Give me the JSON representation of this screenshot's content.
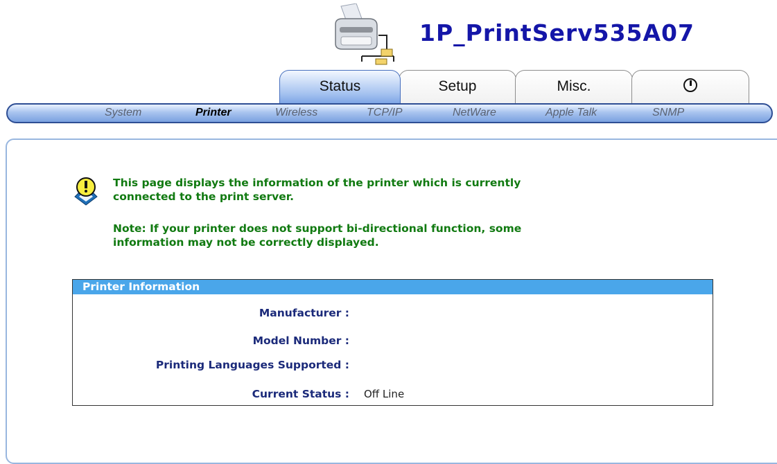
{
  "header": {
    "device_name": "1P_PrintServ535A07",
    "logo_icon": "printer-network-icon"
  },
  "tabs": [
    {
      "label": "Status",
      "active": true
    },
    {
      "label": "Setup",
      "active": false
    },
    {
      "label": "Misc.",
      "active": false
    },
    {
      "label": "",
      "icon": "power-icon",
      "active": false
    }
  ],
  "subnav": [
    {
      "label": "System",
      "current": false
    },
    {
      "label": "Printer",
      "current": true
    },
    {
      "label": "Wireless",
      "current": false
    },
    {
      "label": "TCP/IP",
      "current": false
    },
    {
      "label": "NetWare",
      "current": false
    },
    {
      "label": "Apple Talk",
      "current": false
    },
    {
      "label": "SNMP",
      "current": false
    }
  ],
  "info": {
    "icon": "lightbulb-tip-icon",
    "line1": "This page displays the information of the printer which is currently",
    "line2": "connected to the print server.",
    "note1": "Note: If your printer does not support bi-directional function, some",
    "note2": "information may not be correctly displayed."
  },
  "printer_info": {
    "title": "Printer Information",
    "rows": [
      {
        "label": "Manufacturer :",
        "value": ""
      },
      {
        "label": "Model Number :",
        "value": ""
      },
      {
        "label": "Printing Languages Supported :",
        "value": ""
      },
      {
        "label": "Current Status :",
        "value": "Off Line"
      }
    ]
  },
  "colors": {
    "device_name": "#1416a8",
    "info_text": "#117a11",
    "table_header": "#4aa6ea",
    "label_text": "#1b2a7a",
    "nav_blue": "#7aa1e0"
  }
}
